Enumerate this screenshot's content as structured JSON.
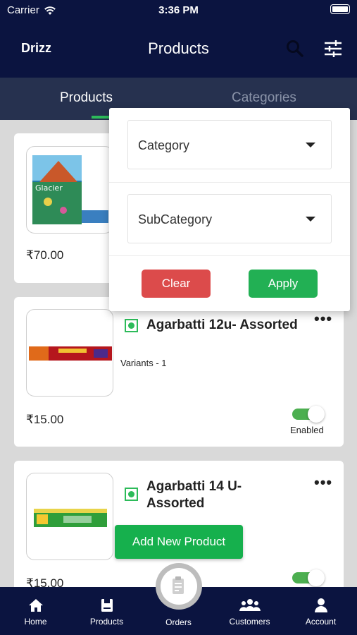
{
  "status": {
    "carrier": "Carrier",
    "time": "3:36 PM"
  },
  "header": {
    "brand": "Drizz",
    "title": "Products"
  },
  "tabs": [
    {
      "label": "Products",
      "active": true
    },
    {
      "label": "Categories",
      "active": false
    }
  ],
  "filter": {
    "category_label": "Category",
    "subcategory_label": "SubCategory",
    "clear_label": "Clear",
    "apply_label": "Apply"
  },
  "products": [
    {
      "name": "",
      "price": "₹70.00"
    },
    {
      "name": "Agarbatti 12u- Assorted",
      "variants": "Variants - 1",
      "price": "₹15.00",
      "status": "Enabled",
      "enabled": true
    },
    {
      "name": "Agarbatti 14 U-\nAssorted",
      "price": "₹15.00",
      "enabled": true
    }
  ],
  "add_button_label": "Add New Product",
  "bottom_nav": [
    {
      "label": "Home",
      "icon": "home-icon"
    },
    {
      "label": "Products",
      "icon": "products-icon"
    },
    {
      "label": "Orders",
      "icon": "orders-icon"
    },
    {
      "label": "Customers",
      "icon": "customers-icon"
    },
    {
      "label": "Account",
      "icon": "account-icon"
    }
  ],
  "colors": {
    "navy": "#0b1440",
    "tabbar": "#26314f",
    "green": "#22b054",
    "red": "#dc4b4b"
  }
}
